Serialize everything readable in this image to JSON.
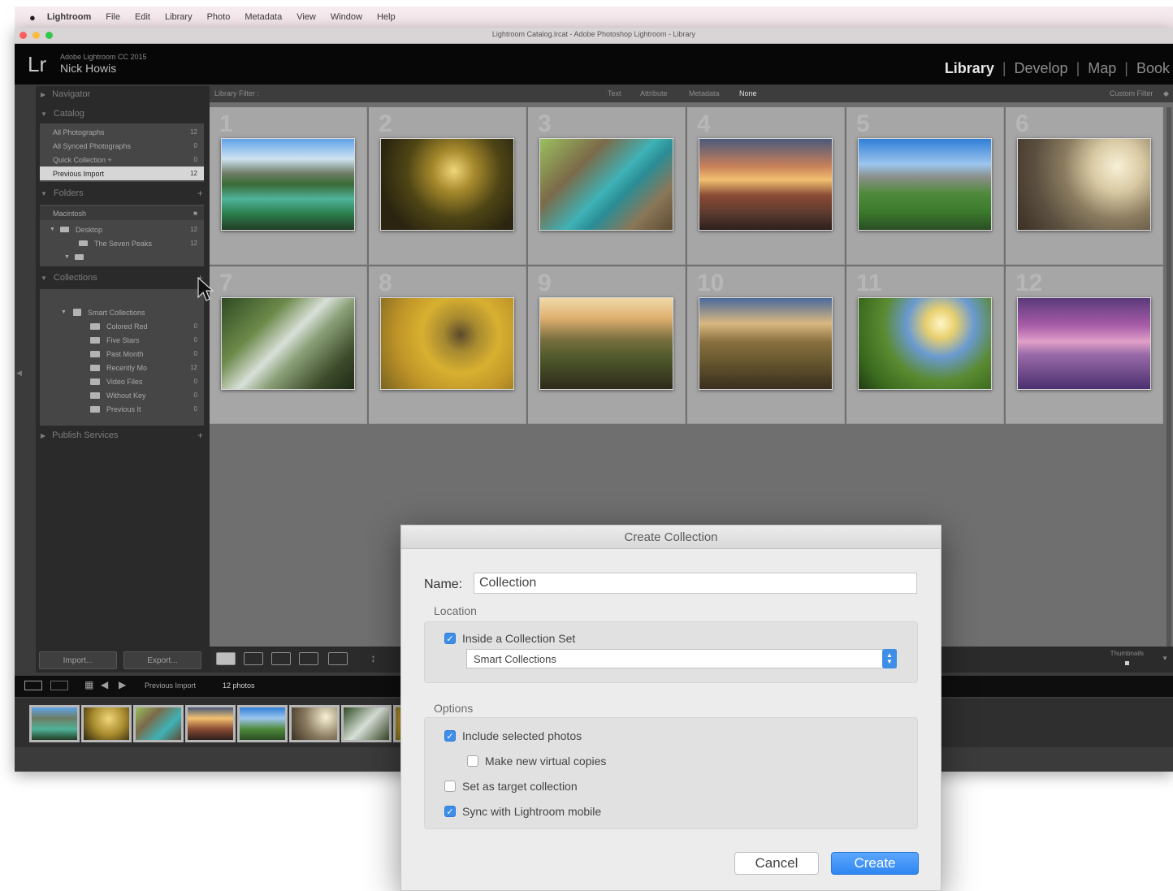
{
  "menubar": {
    "apple": "",
    "items": [
      "Lightroom",
      "File",
      "Edit",
      "Library",
      "Photo",
      "Metadata",
      "View",
      "Window",
      "Help"
    ]
  },
  "window": {
    "title": "Lightroom Catalog.lrcat - Adobe Photoshop Lightroom - Library",
    "traffic_lights": [
      "#fc605c",
      "#fdbc40",
      "#34c84a"
    ]
  },
  "identity": {
    "logo": "Lr",
    "version": "Adobe Lightroom CC 2015",
    "user": "Nick Howis"
  },
  "modules": [
    "Library",
    "Develop",
    "Map",
    "Book"
  ],
  "left_panel": {
    "navigator": "Navigator",
    "catalog": {
      "header": "Catalog",
      "rows": [
        {
          "label": "All Photographs",
          "count": "12"
        },
        {
          "label": "All Synced Photographs",
          "count": "0"
        },
        {
          "label": "Quick Collection +",
          "count": "0"
        },
        {
          "label": "Previous Import",
          "count": "12"
        }
      ]
    },
    "folders": {
      "header": "Folders",
      "volume": "Macintosh",
      "rows": [
        {
          "label": "Desktop",
          "count": "12"
        },
        {
          "label": "The Seven Peaks",
          "count": "12"
        },
        {
          "label": "",
          "count": ""
        }
      ]
    },
    "collections": {
      "header": "Collections",
      "set": "Smart Collections",
      "rows": [
        {
          "label": "Colored Red",
          "count": "0"
        },
        {
          "label": "Five Stars",
          "count": "0"
        },
        {
          "label": "Past Month",
          "count": "0"
        },
        {
          "label": "Recently Mo",
          "count": "12"
        },
        {
          "label": "Video Files",
          "count": "0"
        },
        {
          "label": "Without Key",
          "count": "0"
        },
        {
          "label": "Previous It",
          "count": "0"
        }
      ]
    },
    "publish": "Publish Services",
    "import_btn": "Import...",
    "export_btn": "Export..."
  },
  "filter_bar": {
    "label": "Library Filter :",
    "options": [
      "Text",
      "Attribute",
      "Metadata",
      "None"
    ],
    "custom": "Custom Filter"
  },
  "grid": {
    "cells": [
      {
        "num": "1"
      },
      {
        "num": "2"
      },
      {
        "num": "3"
      },
      {
        "num": "4"
      },
      {
        "num": "5"
      },
      {
        "num": "6"
      },
      {
        "num": "7"
      },
      {
        "num": "8"
      },
      {
        "num": "9"
      },
      {
        "num": "10"
      },
      {
        "num": "11"
      },
      {
        "num": "12"
      }
    ]
  },
  "toolbar": {
    "thumbnails_label": "Thumbnails"
  },
  "filmstrip_bar": {
    "source": "Previous Import",
    "count": "12 photos"
  },
  "dialog": {
    "title": "Create Collection",
    "name_label": "Name:",
    "name_value": "Collection",
    "location_label": "Location",
    "inside_set_label": "Inside a Collection Set",
    "inside_set_checked": true,
    "set_value": "Smart Collections",
    "options_label": "Options",
    "options": [
      {
        "label": "Include selected photos",
        "checked": true
      },
      {
        "label": "Make new virtual copies",
        "checked": false
      },
      {
        "label": "Set as target collection",
        "checked": false
      },
      {
        "label": "Sync with Lightroom mobile",
        "checked": true
      }
    ],
    "cancel": "Cancel",
    "create": "Create"
  },
  "colors": {
    "accent": "#3e8ee8",
    "panel_bg": "#2a2a2a",
    "grid_bg": "#6f6f6f",
    "cell_bg": "#a6a6a6"
  }
}
